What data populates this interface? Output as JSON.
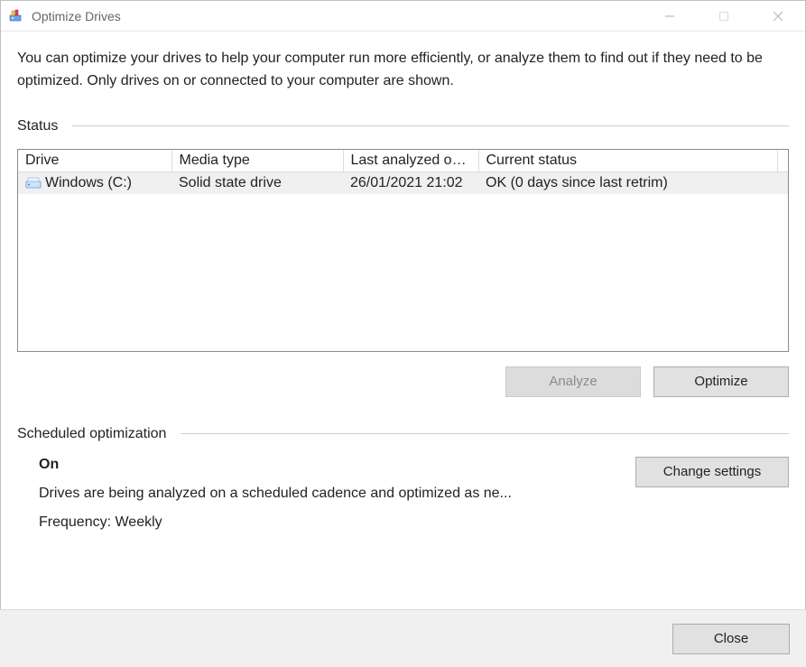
{
  "window": {
    "title": "Optimize Drives"
  },
  "intro": "You can optimize your drives to help your computer run more efficiently, or analyze them to find out if they need to be optimized. Only drives on or connected to your computer are shown.",
  "status": {
    "heading": "Status",
    "columns": {
      "drive": "Drive",
      "media": "Media type",
      "last": "Last analyzed or o...",
      "current": "Current status"
    },
    "rows": [
      {
        "drive": "Windows (C:)",
        "media": "Solid state drive",
        "last": "26/01/2021 21:02",
        "current": "OK (0 days since last retrim)"
      }
    ]
  },
  "buttons": {
    "analyze": "Analyze",
    "optimize": "Optimize",
    "changeSettings": "Change settings",
    "close": "Close"
  },
  "scheduled": {
    "heading": "Scheduled optimization",
    "state": "On",
    "description": "Drives are being analyzed on a scheduled cadence and optimized as ne...",
    "frequency": "Frequency: Weekly"
  }
}
